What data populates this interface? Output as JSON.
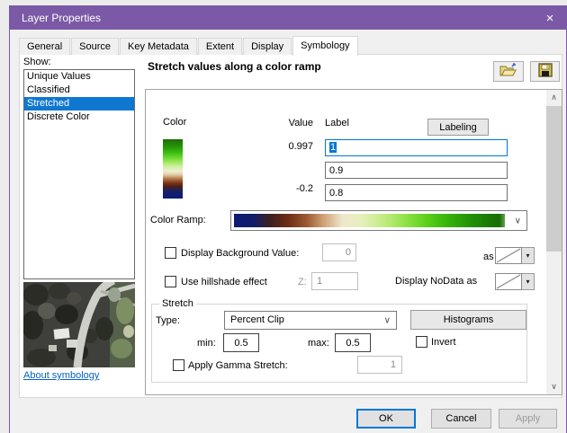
{
  "window": {
    "title": "Layer Properties"
  },
  "glyphs": {
    "close": "×",
    "chevron_down": "∨",
    "chevron_up": "∧",
    "dropdown_arrow": "▾"
  },
  "tabs": {
    "items": [
      {
        "label": "General"
      },
      {
        "label": "Source"
      },
      {
        "label": "Key Metadata"
      },
      {
        "label": "Extent"
      },
      {
        "label": "Display"
      },
      {
        "label": "Symbology"
      }
    ],
    "active": "Symbology"
  },
  "show": {
    "label": "Show:",
    "items": [
      {
        "label": "Unique Values",
        "selected": false
      },
      {
        "label": "Classified",
        "selected": false
      },
      {
        "label": "Stretched",
        "selected": true
      },
      {
        "label": "Discrete Color",
        "selected": false
      }
    ],
    "about_link": "About symbology"
  },
  "symbology": {
    "header": "Stretch values along a color ramp",
    "columns": {
      "color": "Color",
      "value": "Value",
      "label": "Label"
    },
    "labeling_button": "Labeling",
    "rows": [
      {
        "value": "0.997",
        "label": "1"
      },
      {
        "value": "",
        "label": "0.9"
      },
      {
        "value": "-0.2",
        "label": "0.8"
      }
    ],
    "color_ramp_label": "Color Ramp:",
    "background_value": {
      "label": "Display Background Value:",
      "value": "0",
      "as_label": "as"
    },
    "hillshade": {
      "label": "Use hillshade effect",
      "z_label": "Z:",
      "z_value": "1",
      "nodata_label": "Display NoData as"
    },
    "stretch": {
      "legend": "Stretch",
      "type_label": "Type:",
      "type_value": "Percent Clip",
      "histograms_button": "Histograms",
      "min_label": "min:",
      "min_value": "0.5",
      "max_label": "max:",
      "max_value": "0.5",
      "invert_label": "Invert",
      "gamma_label": "Apply Gamma Stretch:",
      "gamma_value": "1"
    }
  },
  "footer": {
    "ok": "OK",
    "cancel": "Cancel",
    "apply": "Apply"
  },
  "colors": {
    "titlebar": "#7b59a6",
    "selection_blue": "#0f77d0",
    "focus_blue": "#0078d7",
    "link_blue": "#0563c1",
    "ramp_horizontal": [
      "#0c1a75 0%",
      "#101d6b 7%",
      "#3a2020 13%",
      "#6e2c14 20%",
      "#9c5a32 27%",
      "#cfa276 33%",
      "#efe7cc 40%",
      "#e7f0bc 47%",
      "#c3ec84 55%",
      "#92e348 63%",
      "#5cd01c 71%",
      "#35b30a 79%",
      "#239207 87%",
      "#1a7a05 94%",
      "#176f04 98%",
      "#68a14e 100%"
    ],
    "ramp_vertical": [
      "#1d6e08 0%",
      "#259207 12%",
      "#3cba10 22%",
      "#63d527 30%",
      "#9ce65c 38%",
      "#cdf09c 46%",
      "#efeed6 54%",
      "#e2cba4 60%",
      "#b07448 67%",
      "#7c3416 74%",
      "#4a2018 80%",
      "#14206e 88%",
      "#0c1a75 100%"
    ]
  }
}
